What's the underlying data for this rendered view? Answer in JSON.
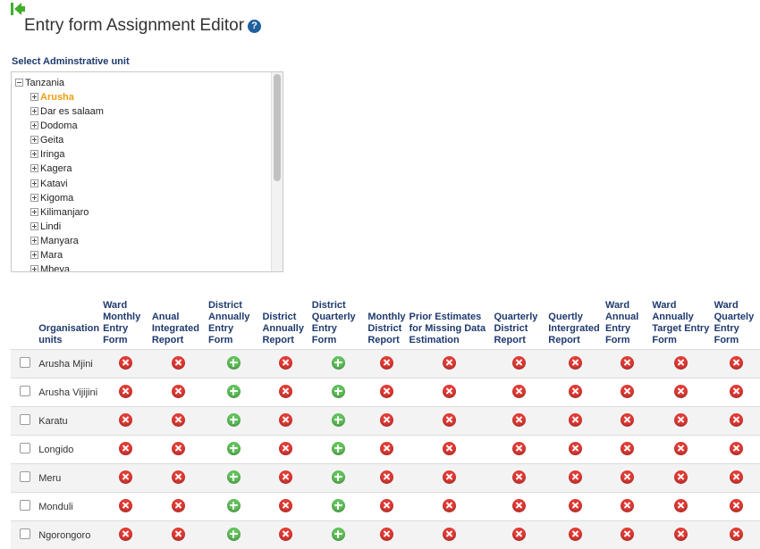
{
  "header": {
    "title": "Entry form Assignment Editor",
    "help_symbol": "?"
  },
  "tree": {
    "section_label": "Select Adminstrative unit",
    "root": "Tanzania",
    "selected": "Arusha",
    "items": [
      "Arusha",
      "Dar es salaam",
      "Dodoma",
      "Geita",
      "Iringa",
      "Kagera",
      "Katavi",
      "Kigoma",
      "Kilimanjaro",
      "Lindi",
      "Manyara",
      "Mara",
      "Mbeya"
    ]
  },
  "table": {
    "columns": [
      "Organisation units",
      "Ward Monthly Entry Form",
      "Anual Integrated Report",
      "District Annually Entry Form",
      "District Annually Report",
      "District Quarterly Entry Form",
      "Monthly District Report",
      "Prior Estimates for Missing Data Estimation",
      "Quarterly District Report",
      "Quertly Intergrated Report",
      "Ward Annual Entry Form",
      "Ward Annually Target Entry Form",
      "Ward Quartely Entry Form"
    ],
    "rows": [
      {
        "unit": "Arusha Mjini",
        "status": [
          "remove",
          "remove",
          "add",
          "remove",
          "add",
          "remove",
          "remove",
          "remove",
          "remove",
          "remove",
          "remove",
          "remove"
        ]
      },
      {
        "unit": "Arusha Vijijini",
        "status": [
          "remove",
          "remove",
          "add",
          "remove",
          "add",
          "remove",
          "remove",
          "remove",
          "remove",
          "remove",
          "remove",
          "remove"
        ]
      },
      {
        "unit": "Karatu",
        "status": [
          "remove",
          "remove",
          "add",
          "remove",
          "add",
          "remove",
          "remove",
          "remove",
          "remove",
          "remove",
          "remove",
          "remove"
        ]
      },
      {
        "unit": "Longido",
        "status": [
          "remove",
          "remove",
          "add",
          "remove",
          "add",
          "remove",
          "remove",
          "remove",
          "remove",
          "remove",
          "remove",
          "remove"
        ]
      },
      {
        "unit": "Meru",
        "status": [
          "remove",
          "remove",
          "add",
          "remove",
          "add",
          "remove",
          "remove",
          "remove",
          "remove",
          "remove",
          "remove",
          "remove"
        ]
      },
      {
        "unit": "Monduli",
        "status": [
          "remove",
          "remove",
          "add",
          "remove",
          "add",
          "remove",
          "remove",
          "remove",
          "remove",
          "remove",
          "remove",
          "remove"
        ]
      },
      {
        "unit": "Ngorongoro",
        "status": [
          "remove",
          "remove",
          "add",
          "remove",
          "add",
          "remove",
          "remove",
          "remove",
          "remove",
          "remove",
          "remove",
          "remove"
        ]
      }
    ]
  },
  "colors": {
    "remove": "#e33b35",
    "add": "#62c25b",
    "selected_text": "#f39c12",
    "header_text": "#1f3a6e",
    "back_icon": "#3fae2a"
  }
}
